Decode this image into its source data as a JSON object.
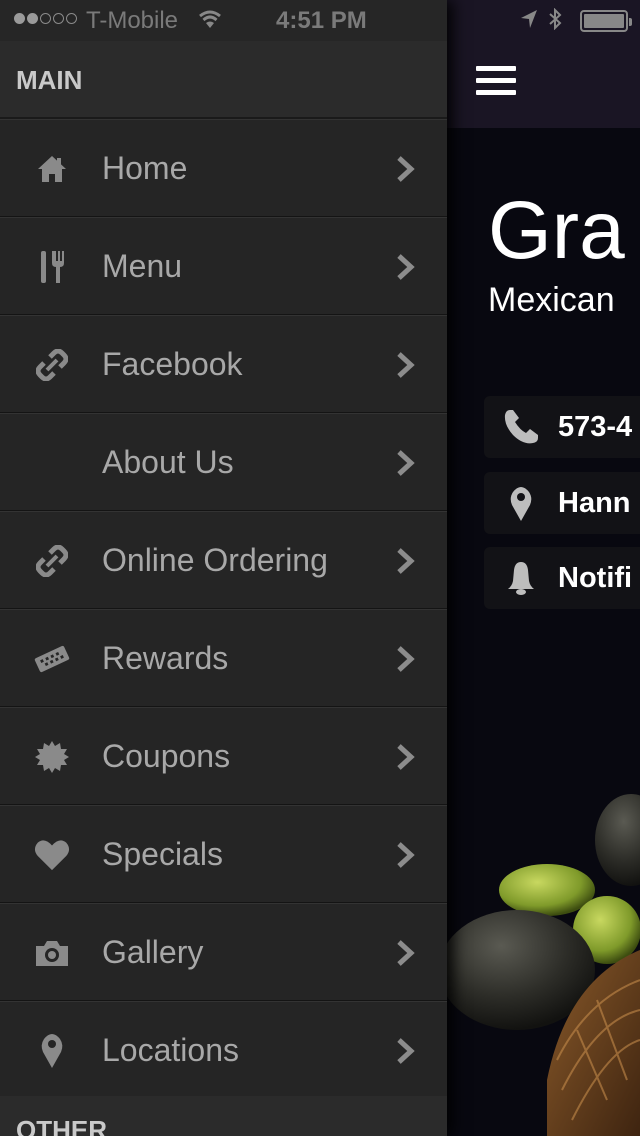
{
  "status_bar": {
    "carrier": "T-Mobile",
    "time": "4:51 PM",
    "signal_bars_filled": 2,
    "signal_bars_total": 5,
    "battery_level": 1.0
  },
  "drawer": {
    "main_header": "MAIN",
    "other_header": "OTHER",
    "items": [
      {
        "label": "Home",
        "icon": "home-icon"
      },
      {
        "label": "Menu",
        "icon": "fork-knife-icon"
      },
      {
        "label": "Facebook",
        "icon": "link-icon"
      },
      {
        "label": "About Us",
        "icon": ""
      },
      {
        "label": "Online Ordering",
        "icon": "link-icon"
      },
      {
        "label": "Rewards",
        "icon": "ticket-icon"
      },
      {
        "label": "Coupons",
        "icon": "badge-icon"
      },
      {
        "label": "Specials",
        "icon": "heart-icon"
      },
      {
        "label": "Gallery",
        "icon": "camera-icon"
      },
      {
        "label": "Locations",
        "icon": "map-pin-icon"
      }
    ]
  },
  "content": {
    "brand_name": "Gra",
    "brand_subtitle": "Mexican",
    "phone_text": "573-4",
    "location_text": "Hann",
    "notification_text": "Notifi"
  },
  "colors": {
    "drawer_bg": "#252525",
    "header_bg": "#2b2b2b",
    "topbar_bg": "#1a1524",
    "menu_text": "#a8a8a8",
    "icon_gray": "#8a8a8a"
  }
}
